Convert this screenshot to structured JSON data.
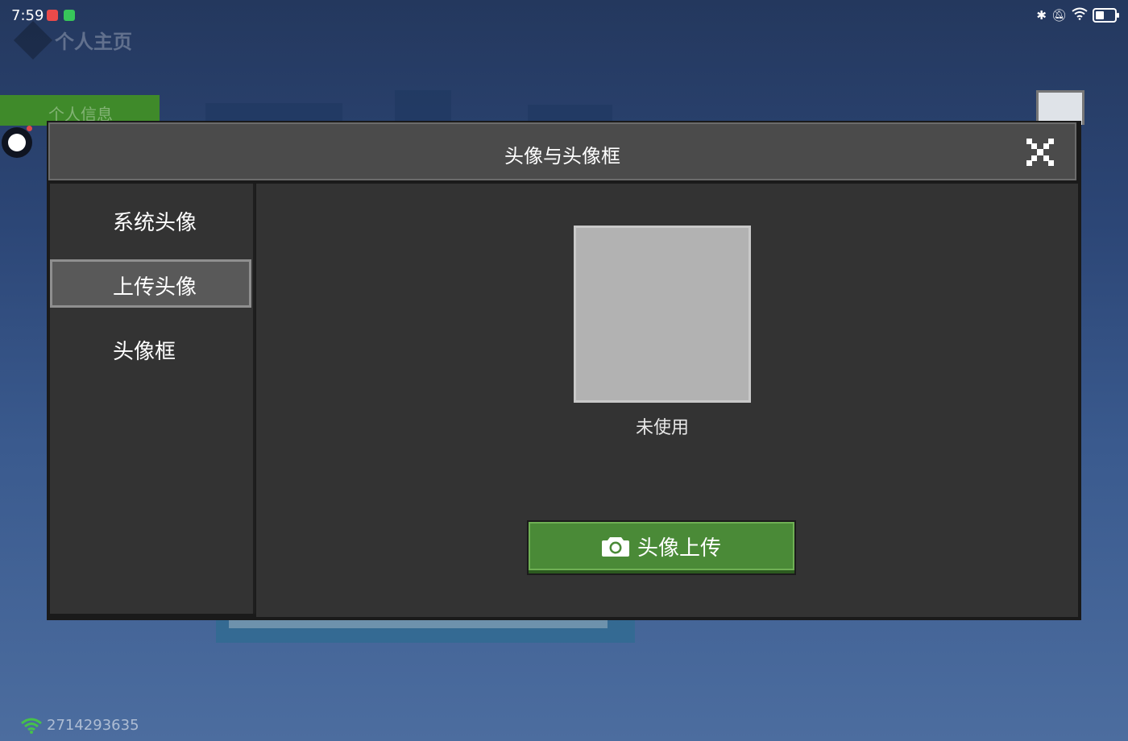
{
  "status_bar": {
    "time": "7:59"
  },
  "background": {
    "page_title": "个人主页",
    "green_tab_label": "个人信息"
  },
  "dialog": {
    "title": "头像与头像框",
    "sidebar": {
      "items": [
        {
          "label": "系统头像",
          "active": false
        },
        {
          "label": "上传头像",
          "active": true
        },
        {
          "label": "头像框",
          "active": false
        }
      ]
    },
    "content": {
      "avatar_caption": "未使用",
      "upload_button_label": "头像上传"
    }
  },
  "footer": {
    "user_id": "2714293635"
  },
  "colors": {
    "accent_green": "#4a8a37",
    "dialog_bg": "#333333",
    "header_bg": "#4b4b4b"
  },
  "icons": {
    "close": "close-icon",
    "camera": "camera-icon",
    "wifi": "wifi-icon"
  }
}
